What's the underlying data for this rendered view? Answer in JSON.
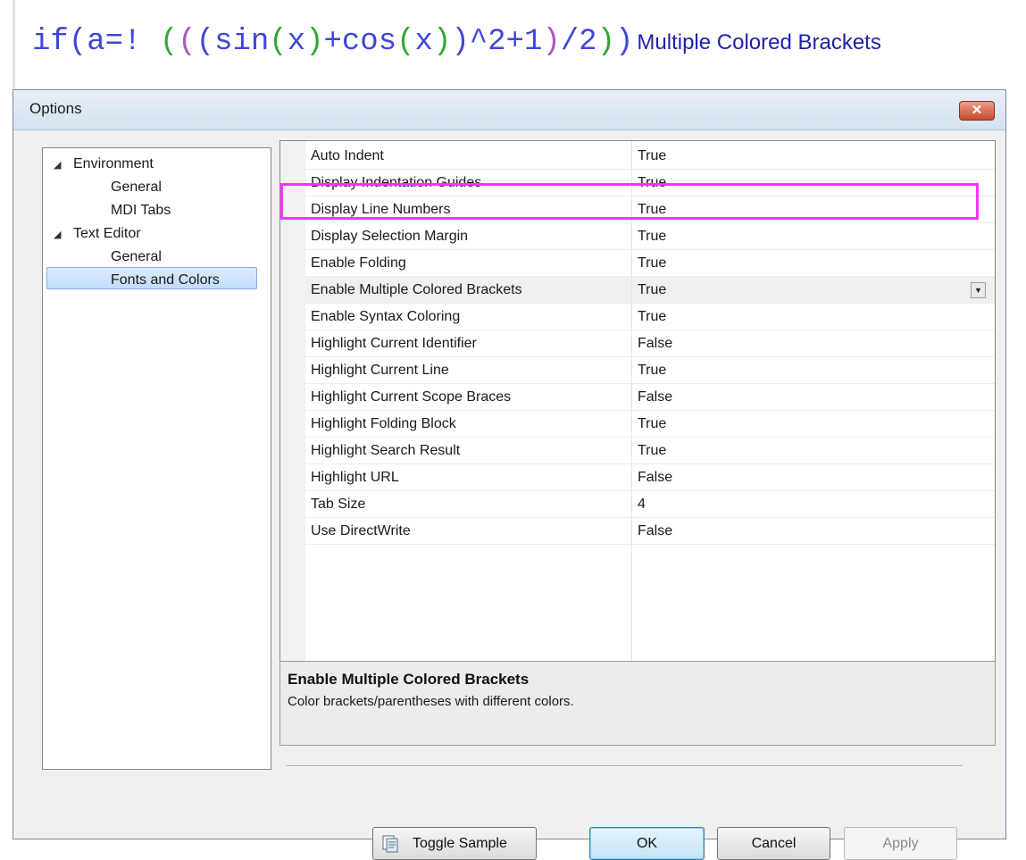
{
  "banner": {
    "code_tokens": [
      {
        "text": "if",
        "color": "#3f47d6"
      },
      {
        "text": "(",
        "color": "#3f47d6"
      },
      {
        "text": "a=!",
        "color": "#3f47d6"
      },
      {
        "text": " (",
        "color": "#2fa82f"
      },
      {
        "text": "(",
        "color": "#a855c8"
      },
      {
        "text": "(",
        "color": "#3f47d6"
      },
      {
        "text": "sin",
        "color": "#3f47d6"
      },
      {
        "text": "(",
        "color": "#2fa82f"
      },
      {
        "text": "x",
        "color": "#3f47d6"
      },
      {
        "text": ")",
        "color": "#2fa82f"
      },
      {
        "text": "+cos",
        "color": "#3f47d6"
      },
      {
        "text": "(",
        "color": "#2fa82f"
      },
      {
        "text": "x",
        "color": "#3f47d6"
      },
      {
        "text": ")",
        "color": "#2fa82f"
      },
      {
        "text": ")",
        "color": "#3f47d6"
      },
      {
        "text": "^2+1",
        "color": "#3f47d6"
      },
      {
        "text": ")",
        "color": "#a855c8"
      },
      {
        "text": "/2",
        "color": "#3f47d6"
      },
      {
        "text": ")",
        "color": "#2fa82f"
      },
      {
        "text": ")",
        "color": "#3f47d6"
      }
    ],
    "label": "Multiple Colored Brackets"
  },
  "dialog": {
    "title": "Options",
    "close_glyph": "✕"
  },
  "tree": {
    "items": [
      {
        "label": "Environment",
        "expander": "◢",
        "level": 0
      },
      {
        "label": "General",
        "level": 1
      },
      {
        "label": "MDI Tabs",
        "level": 1
      },
      {
        "label": "Text Editor",
        "expander": "◢",
        "level": 0
      },
      {
        "label": "General",
        "level": 1,
        "selected": true
      },
      {
        "label": "Fonts and Colors",
        "level": 1
      }
    ]
  },
  "properties": {
    "rows": [
      {
        "name": "Auto Indent",
        "value": "True"
      },
      {
        "name": "Display Indentation Guides",
        "value": "True"
      },
      {
        "name": "Display Line Numbers",
        "value": "True"
      },
      {
        "name": "Display Selection Margin",
        "value": "True"
      },
      {
        "name": "Enable Folding",
        "value": "True"
      },
      {
        "name": "Enable Multiple Colored Brackets",
        "value": "True",
        "selected": true
      },
      {
        "name": "Enable Syntax Coloring",
        "value": "True"
      },
      {
        "name": "Highlight Current Identifier",
        "value": "False"
      },
      {
        "name": "Highlight Current Line",
        "value": "True"
      },
      {
        "name": "Highlight Current Scope Braces",
        "value": "False"
      },
      {
        "name": "Highlight Folding Block",
        "value": "True"
      },
      {
        "name": "Highlight Search Result",
        "value": "True"
      },
      {
        "name": "Highlight URL",
        "value": "False"
      },
      {
        "name": "Tab Size",
        "value": "4"
      },
      {
        "name": "Use DirectWrite",
        "value": "False"
      }
    ],
    "highlight_color": "#ff32ff"
  },
  "description": {
    "title": "Enable Multiple Colored Brackets",
    "text": "Color brackets/parentheses with different colors."
  },
  "buttons": {
    "toggle_sample": "Toggle Sample",
    "ok": "OK",
    "cancel": "Cancel",
    "apply": "Apply"
  }
}
